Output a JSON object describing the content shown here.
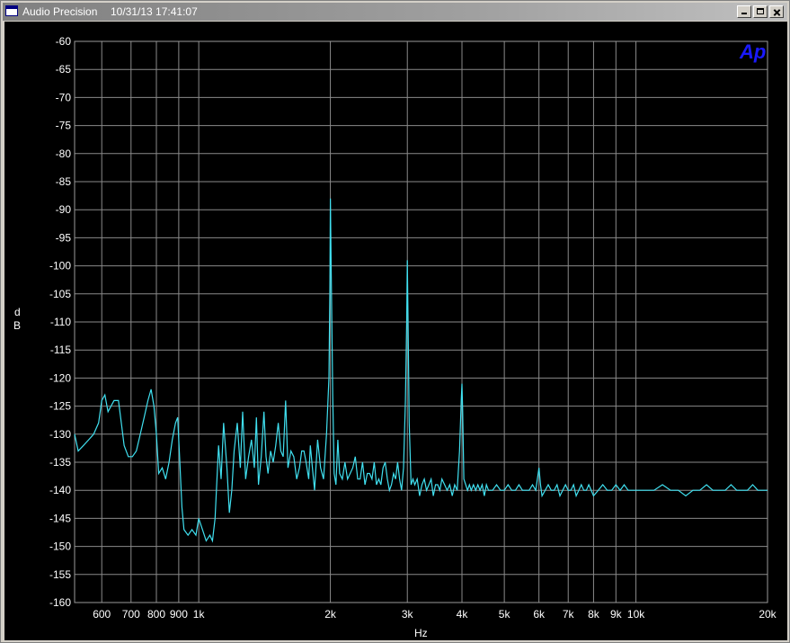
{
  "window": {
    "title": "Audio Precision",
    "timestamp": "10/31/13 17:41:07",
    "minimize_label": "",
    "maximize_label": "",
    "close_label": ""
  },
  "logo": "Ap",
  "colors": {
    "trace": "#40e0f0",
    "grid": "#8a8a8a",
    "background": "#000000",
    "logo": "#1a1aff"
  },
  "chart_data": {
    "type": "line",
    "title": "",
    "xlabel": "Hz",
    "ylabel": "dB",
    "x_scale": "log",
    "xlim": [
      520,
      20000
    ],
    "ylim": [
      -160,
      -60
    ],
    "grid": true,
    "y_ticks": [
      -60,
      -65,
      -70,
      -75,
      -80,
      -85,
      -90,
      -95,
      -100,
      -105,
      -110,
      -115,
      -120,
      -125,
      -130,
      -135,
      -140,
      -145,
      -150,
      -155,
      -160
    ],
    "x_ticks": [
      {
        "value": 600,
        "label": "600"
      },
      {
        "value": 700,
        "label": "700"
      },
      {
        "value": 800,
        "label": "800"
      },
      {
        "value": 900,
        "label": "900"
      },
      {
        "value": 1000,
        "label": "1k"
      },
      {
        "value": 2000,
        "label": "2k"
      },
      {
        "value": 3000,
        "label": "3k"
      },
      {
        "value": 4000,
        "label": "4k"
      },
      {
        "value": 5000,
        "label": "5k"
      },
      {
        "value": 6000,
        "label": "6k"
      },
      {
        "value": 7000,
        "label": "7k"
      },
      {
        "value": 8000,
        "label": "8k"
      },
      {
        "value": 9000,
        "label": "9k"
      },
      {
        "value": 10000,
        "label": "10k"
      },
      {
        "value": 20000,
        "label": "20k"
      }
    ],
    "series": [
      {
        "points": [
          [
            520,
            -130
          ],
          [
            530,
            -133
          ],
          [
            545,
            -132
          ],
          [
            560,
            -131
          ],
          [
            575,
            -130
          ],
          [
            590,
            -128
          ],
          [
            600,
            -124
          ],
          [
            610,
            -123
          ],
          [
            620,
            -126
          ],
          [
            630,
            -125
          ],
          [
            640,
            -124
          ],
          [
            655,
            -124
          ],
          [
            665,
            -128
          ],
          [
            675,
            -132
          ],
          [
            690,
            -134
          ],
          [
            705,
            -134
          ],
          [
            720,
            -133
          ],
          [
            735,
            -130
          ],
          [
            750,
            -127
          ],
          [
            765,
            -124
          ],
          [
            778,
            -122
          ],
          [
            790,
            -125
          ],
          [
            800,
            -130
          ],
          [
            810,
            -137
          ],
          [
            825,
            -136
          ],
          [
            840,
            -138
          ],
          [
            855,
            -135
          ],
          [
            870,
            -131
          ],
          [
            885,
            -128
          ],
          [
            895,
            -127
          ],
          [
            905,
            -135
          ],
          [
            915,
            -143
          ],
          [
            925,
            -147
          ],
          [
            945,
            -148
          ],
          [
            965,
            -147
          ],
          [
            985,
            -148
          ],
          [
            1000,
            -145
          ],
          [
            1020,
            -147
          ],
          [
            1040,
            -149
          ],
          [
            1060,
            -148
          ],
          [
            1075,
            -149
          ],
          [
            1090,
            -145
          ],
          [
            1110,
            -132
          ],
          [
            1125,
            -138
          ],
          [
            1140,
            -128
          ],
          [
            1160,
            -136
          ],
          [
            1175,
            -144
          ],
          [
            1190,
            -140
          ],
          [
            1205,
            -133
          ],
          [
            1225,
            -128
          ],
          [
            1245,
            -136
          ],
          [
            1260,
            -126
          ],
          [
            1280,
            -138
          ],
          [
            1300,
            -134
          ],
          [
            1320,
            -131
          ],
          [
            1340,
            -136
          ],
          [
            1355,
            -127
          ],
          [
            1370,
            -139
          ],
          [
            1390,
            -134
          ],
          [
            1410,
            -126
          ],
          [
            1425,
            -134
          ],
          [
            1440,
            -137
          ],
          [
            1460,
            -133
          ],
          [
            1480,
            -135
          ],
          [
            1500,
            -132
          ],
          [
            1520,
            -128
          ],
          [
            1540,
            -133
          ],
          [
            1560,
            -134
          ],
          [
            1580,
            -124
          ],
          [
            1600,
            -136
          ],
          [
            1625,
            -133
          ],
          [
            1650,
            -134
          ],
          [
            1675,
            -138
          ],
          [
            1700,
            -136
          ],
          [
            1720,
            -133
          ],
          [
            1740,
            -133
          ],
          [
            1760,
            -135
          ],
          [
            1785,
            -138
          ],
          [
            1800,
            -132
          ],
          [
            1820,
            -136
          ],
          [
            1840,
            -140
          ],
          [
            1870,
            -131
          ],
          [
            1900,
            -136
          ],
          [
            1930,
            -138
          ],
          [
            1960,
            -130
          ],
          [
            1985,
            -120
          ],
          [
            1995,
            -105
          ],
          [
            2000,
            -88
          ],
          [
            2010,
            -102
          ],
          [
            2025,
            -123
          ],
          [
            2040,
            -137
          ],
          [
            2060,
            -139
          ],
          [
            2080,
            -131
          ],
          [
            2100,
            -137
          ],
          [
            2130,
            -138
          ],
          [
            2160,
            -135
          ],
          [
            2190,
            -138
          ],
          [
            2220,
            -137
          ],
          [
            2250,
            -136
          ],
          [
            2280,
            -134
          ],
          [
            2310,
            -138
          ],
          [
            2340,
            -138
          ],
          [
            2370,
            -135
          ],
          [
            2400,
            -139
          ],
          [
            2430,
            -137
          ],
          [
            2460,
            -137
          ],
          [
            2490,
            -138
          ],
          [
            2520,
            -135
          ],
          [
            2550,
            -139
          ],
          [
            2580,
            -138
          ],
          [
            2610,
            -139
          ],
          [
            2640,
            -136
          ],
          [
            2670,
            -135
          ],
          [
            2700,
            -138
          ],
          [
            2730,
            -140
          ],
          [
            2760,
            -139
          ],
          [
            2790,
            -137
          ],
          [
            2820,
            -138
          ],
          [
            2850,
            -135
          ],
          [
            2880,
            -138
          ],
          [
            2910,
            -140
          ],
          [
            2940,
            -136
          ],
          [
            2970,
            -124
          ],
          [
            2990,
            -110
          ],
          [
            3000,
            -99
          ],
          [
            3010,
            -108
          ],
          [
            3030,
            -128
          ],
          [
            3060,
            -139
          ],
          [
            3090,
            -138
          ],
          [
            3120,
            -139
          ],
          [
            3160,
            -138
          ],
          [
            3200,
            -141
          ],
          [
            3240,
            -139
          ],
          [
            3280,
            -138
          ],
          [
            3320,
            -140
          ],
          [
            3360,
            -139
          ],
          [
            3400,
            -138
          ],
          [
            3440,
            -141
          ],
          [
            3480,
            -139
          ],
          [
            3520,
            -139
          ],
          [
            3560,
            -140
          ],
          [
            3600,
            -138
          ],
          [
            3650,
            -139
          ],
          [
            3700,
            -140
          ],
          [
            3750,
            -139
          ],
          [
            3800,
            -141
          ],
          [
            3850,
            -139
          ],
          [
            3900,
            -140
          ],
          [
            3950,
            -133
          ],
          [
            3985,
            -124
          ],
          [
            4000,
            -121
          ],
          [
            4015,
            -126
          ],
          [
            4040,
            -138
          ],
          [
            4080,
            -139
          ],
          [
            4120,
            -140
          ],
          [
            4160,
            -139
          ],
          [
            4200,
            -140
          ],
          [
            4250,
            -139
          ],
          [
            4300,
            -140
          ],
          [
            4350,
            -139
          ],
          [
            4400,
            -140
          ],
          [
            4450,
            -139
          ],
          [
            4500,
            -141
          ],
          [
            4550,
            -139
          ],
          [
            4600,
            -140
          ],
          [
            4700,
            -140
          ],
          [
            4800,
            -139
          ],
          [
            4900,
            -140
          ],
          [
            5000,
            -140
          ],
          [
            5100,
            -139
          ],
          [
            5200,
            -140
          ],
          [
            5300,
            -140
          ],
          [
            5400,
            -139
          ],
          [
            5500,
            -140
          ],
          [
            5600,
            -140
          ],
          [
            5700,
            -140
          ],
          [
            5800,
            -139
          ],
          [
            5900,
            -140
          ],
          [
            6000,
            -136
          ],
          [
            6050,
            -139
          ],
          [
            6100,
            -141
          ],
          [
            6200,
            -140
          ],
          [
            6300,
            -139
          ],
          [
            6400,
            -140
          ],
          [
            6500,
            -140
          ],
          [
            6600,
            -139
          ],
          [
            6700,
            -141
          ],
          [
            6800,
            -140
          ],
          [
            6900,
            -139
          ],
          [
            7000,
            -140
          ],
          [
            7100,
            -140
          ],
          [
            7200,
            -139
          ],
          [
            7300,
            -141
          ],
          [
            7400,
            -140
          ],
          [
            7500,
            -139
          ],
          [
            7600,
            -140
          ],
          [
            7700,
            -140
          ],
          [
            7800,
            -139
          ],
          [
            7900,
            -140
          ],
          [
            8000,
            -141
          ],
          [
            8200,
            -140
          ],
          [
            8400,
            -139
          ],
          [
            8600,
            -140
          ],
          [
            8800,
            -140
          ],
          [
            9000,
            -139
          ],
          [
            9200,
            -140
          ],
          [
            9400,
            -139
          ],
          [
            9600,
            -140
          ],
          [
            9800,
            -140
          ],
          [
            10000,
            -140
          ],
          [
            10500,
            -140
          ],
          [
            11000,
            -140
          ],
          [
            11500,
            -139
          ],
          [
            12000,
            -140
          ],
          [
            12500,
            -140
          ],
          [
            13000,
            -141
          ],
          [
            13500,
            -140
          ],
          [
            14000,
            -140
          ],
          [
            14500,
            -139
          ],
          [
            15000,
            -140
          ],
          [
            15500,
            -140
          ],
          [
            16000,
            -140
          ],
          [
            16500,
            -139
          ],
          [
            17000,
            -140
          ],
          [
            17500,
            -140
          ],
          [
            18000,
            -140
          ],
          [
            18500,
            -139
          ],
          [
            19000,
            -140
          ],
          [
            19500,
            -140
          ],
          [
            20000,
            -140
          ]
        ]
      }
    ]
  }
}
